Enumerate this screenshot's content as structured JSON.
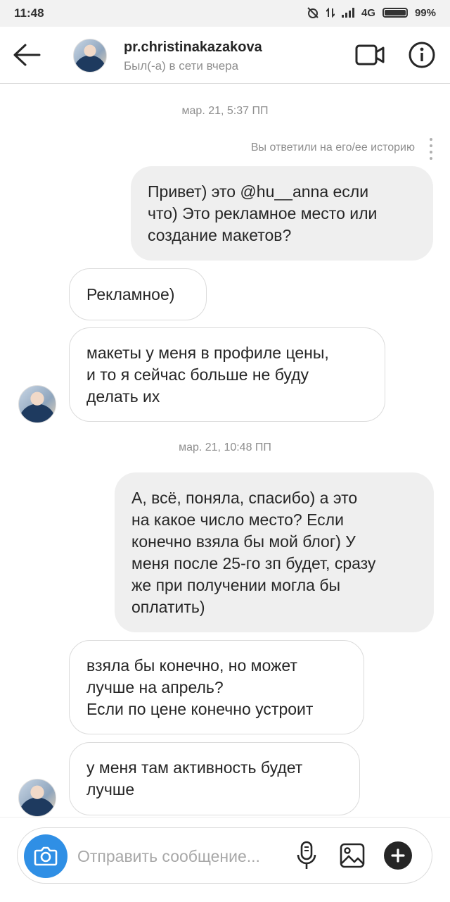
{
  "status_bar": {
    "time": "11:48",
    "network": "4G",
    "battery": "99%",
    "battery_level": 0.99
  },
  "header": {
    "username": "pr.christinakazakova",
    "status": "Был(-а) в сети вчера",
    "icons": [
      "back-arrow-icon",
      "avatar",
      "video-camera-icon",
      "info-icon"
    ]
  },
  "thread": {
    "timestamp_1": "мар. 21, 5:37 ПП",
    "story_reply_note": "Вы ответили на его/ее историю",
    "timestamp_2": "мар. 21, 10:48 ПП",
    "messages": [
      {
        "direction": "outgoing",
        "text": "Привет) это @hu__anna если\nчто) Это рекламное место или\nсоздание макетов?"
      },
      {
        "direction": "incoming",
        "text": "Рекламное)"
      },
      {
        "direction": "incoming",
        "text": "макеты у меня в профиле цены,\nи то я сейчас больше не буду\nделать их"
      },
      {
        "direction": "outgoing",
        "text": "А, всё, поняла, спасибо) а это\nна какое число место? Если\nконечно взяла бы мой блог) У\nменя после 25-го зп будет, сразу\nже при получении могла бы\nоплатить)"
      },
      {
        "direction": "incoming",
        "text": "взяла бы конечно, но может\nлучше на апрель?\nЕсли по цене конечно устроит"
      },
      {
        "direction": "incoming",
        "text": "у меня там активность будет\nлучше"
      }
    ]
  },
  "composer": {
    "placeholder": "Отправить сообщение...",
    "icons": [
      "camera-icon",
      "microphone-icon",
      "gallery-icon",
      "plus-icon"
    ],
    "accent_color": "#2f8fe5"
  },
  "colors": {
    "outgoing_bubble": "#efefef",
    "incoming_border": "#dbdbdb",
    "meta_text": "#8e8e8e"
  }
}
